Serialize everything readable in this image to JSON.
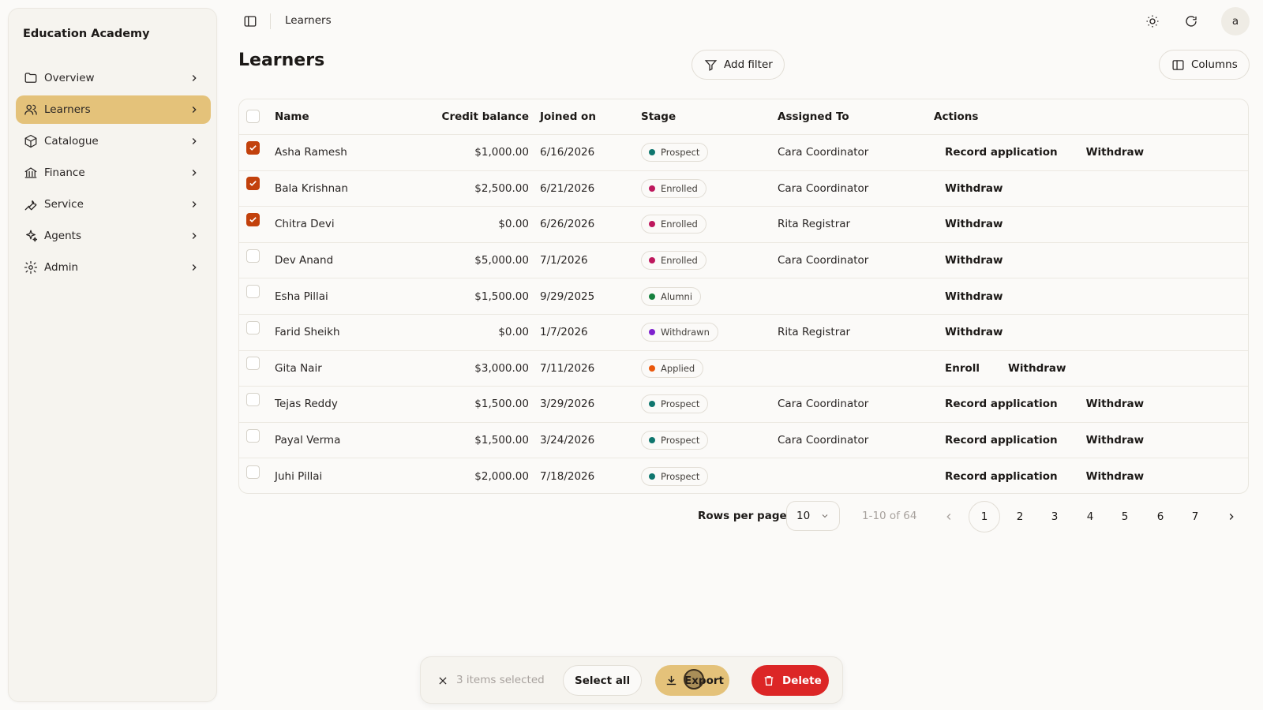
{
  "sidebar": {
    "brand": "Education Academy",
    "items": [
      {
        "label": "Overview",
        "icon": "folder-icon"
      },
      {
        "label": "Learners",
        "icon": "users-icon",
        "active": true
      },
      {
        "label": "Catalogue",
        "icon": "package-icon"
      },
      {
        "label": "Finance",
        "icon": "bank-icon"
      },
      {
        "label": "Service",
        "icon": "wrench-icon"
      },
      {
        "label": "Agents",
        "icon": "sparkles-icon"
      },
      {
        "label": "Admin",
        "icon": "gear-icon"
      }
    ]
  },
  "topbar": {
    "breadcrumb": "Learners",
    "avatar": "a",
    "icons": [
      "sidebar-toggle-icon",
      "sun-icon",
      "refresh-icon"
    ]
  },
  "page": {
    "title": "Learners",
    "add_filter": "Add filter",
    "columns": "Columns"
  },
  "table": {
    "headers": {
      "name": "Name",
      "credit": "Credit balance",
      "joined": "Joined on",
      "stage": "Stage",
      "assigned": "Assigned To",
      "actions": "Actions"
    },
    "rows": [
      {
        "checked": true,
        "name": "Asha Ramesh",
        "credit": "$1,000.00",
        "joined": "6/16/2026",
        "stage": "Prospect",
        "assigned": "Cara Coordinator",
        "actions": [
          "Record application",
          "Withdraw"
        ]
      },
      {
        "checked": true,
        "name": "Bala Krishnan",
        "credit": "$2,500.00",
        "joined": "6/21/2026",
        "stage": "Enrolled",
        "assigned": "Cara Coordinator",
        "actions": [
          "Withdraw"
        ]
      },
      {
        "checked": true,
        "name": "Chitra Devi",
        "credit": "$0.00",
        "joined": "6/26/2026",
        "stage": "Enrolled",
        "assigned": "Rita Registrar",
        "actions": [
          "Withdraw"
        ]
      },
      {
        "checked": false,
        "name": "Dev Anand",
        "credit": "$5,000.00",
        "joined": "7/1/2026",
        "stage": "Enrolled",
        "assigned": "Cara Coordinator",
        "actions": [
          "Withdraw"
        ]
      },
      {
        "checked": false,
        "name": "Esha Pillai",
        "credit": "$1,500.00",
        "joined": "9/29/2025",
        "stage": "Alumni",
        "assigned": "",
        "actions": [
          "Withdraw"
        ]
      },
      {
        "checked": false,
        "name": "Farid Sheikh",
        "credit": "$0.00",
        "joined": "1/7/2026",
        "stage": "Withdrawn",
        "assigned": "Rita Registrar",
        "actions": [
          "Withdraw"
        ]
      },
      {
        "checked": false,
        "name": "Gita Nair",
        "credit": "$3,000.00",
        "joined": "7/11/2026",
        "stage": "Applied",
        "assigned": "",
        "actions": [
          "Enroll",
          "Withdraw"
        ]
      },
      {
        "checked": false,
        "name": "Tejas Reddy",
        "credit": "$1,500.00",
        "joined": "3/29/2026",
        "stage": "Prospect",
        "assigned": "Cara Coordinator",
        "actions": [
          "Record application",
          "Withdraw"
        ]
      },
      {
        "checked": false,
        "name": "Payal Verma",
        "credit": "$1,500.00",
        "joined": "3/24/2026",
        "stage": "Prospect",
        "assigned": "Cara Coordinator",
        "actions": [
          "Record application",
          "Withdraw"
        ]
      },
      {
        "checked": false,
        "name": "Juhi Pillai",
        "credit": "$2,000.00",
        "joined": "7/18/2026",
        "stage": "Prospect",
        "assigned": "",
        "actions": [
          "Record application",
          "Withdraw"
        ]
      }
    ]
  },
  "stage_colors": {
    "Prospect": "#0f766e",
    "Enrolled": "#be185d",
    "Alumni": "#15803d",
    "Withdrawn": "#7e22ce",
    "Applied": "#ea580c"
  },
  "pagination": {
    "rows_label": "Rows per page:",
    "rows_value": "10",
    "range": "1-10 of 64",
    "pages": [
      "1",
      "2",
      "3",
      "4",
      "5",
      "6",
      "7"
    ],
    "current": "1"
  },
  "bulk": {
    "count": "3 items selected",
    "select_all": "Select all",
    "export": "Export",
    "delete": "Delete"
  },
  "colors": {
    "accent": "#e4c27a",
    "danger": "#dc2626",
    "checkbox": "#c2410c"
  }
}
